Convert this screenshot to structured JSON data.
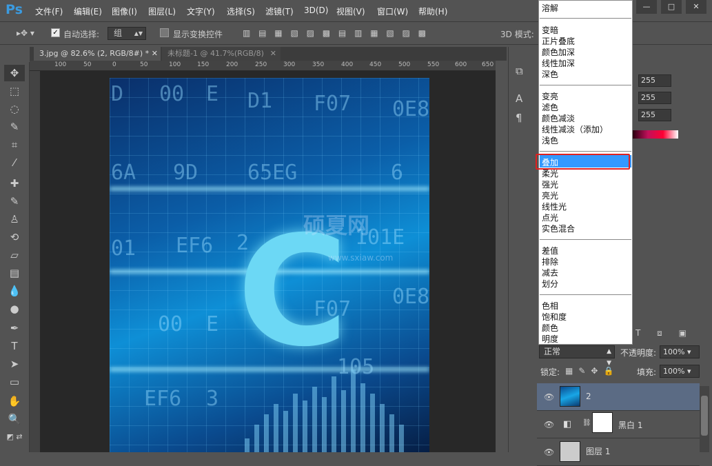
{
  "app": {
    "logo": "Ps"
  },
  "menu": [
    "文件(F)",
    "编辑(E)",
    "图像(I)",
    "图层(L)",
    "文字(Y)",
    "选择(S)",
    "滤镜(T)",
    "3D(D)",
    "视图(V)",
    "窗口(W)",
    "帮助(H)"
  ],
  "options": {
    "auto_select_label": "自动选择:",
    "auto_select_value": "组",
    "show_transform_label": "显示变换控件",
    "mode_3d_label": "3D 模式:"
  },
  "tabs": [
    "3.jpg @ 82.6% (2, RGB/8#) *",
    "未标题-1 @ 41.7%(RGB/8)"
  ],
  "ruler_ticks": [
    "100",
    "50",
    "0",
    "50",
    "100",
    "150",
    "200",
    "250",
    "300",
    "350",
    "400",
    "450",
    "500",
    "550",
    "600",
    "650"
  ],
  "artwork": {
    "big_letter": "C",
    "codes": [
      "D",
      "00",
      "E",
      "D1",
      "F07",
      "0E8",
      "6A",
      "9D",
      "65EG",
      "6",
      "01",
      "EF6",
      "2",
      "101E",
      "00",
      "E",
      "F07",
      "0E8",
      "EF6",
      "3",
      "105"
    ],
    "watermark": "硕夏网",
    "watermark_url": "www.sxiaw.com"
  },
  "blend_modes": {
    "groups": [
      [
        "溶解"
      ],
      [
        "变暗",
        "正片叠底",
        "颜色加深",
        "线性加深",
        "深色"
      ],
      [
        "变亮",
        "滤色",
        "颜色减淡",
        "线性减淡（添加）",
        "浅色"
      ],
      [
        "叠加",
        "柔光",
        "强光",
        "亮光",
        "线性光",
        "点光",
        "实色混合"
      ],
      [
        "差值",
        "排除",
        "减去",
        "划分"
      ],
      [
        "色相",
        "饱和度",
        "颜色",
        "明度"
      ]
    ],
    "highlighted": "叠加"
  },
  "properties": {
    "r": "255",
    "g": "255",
    "b": "255"
  },
  "layers_panel": {
    "blend_mode": "正常",
    "opacity_label": "不透明度:",
    "opacity": "100%",
    "lock_label": "锁定:",
    "fill_label": "填充:",
    "fill": "100%",
    "layers": [
      {
        "name": "2"
      },
      {
        "name": "黑白 1"
      },
      {
        "name": "图层 1"
      }
    ]
  }
}
